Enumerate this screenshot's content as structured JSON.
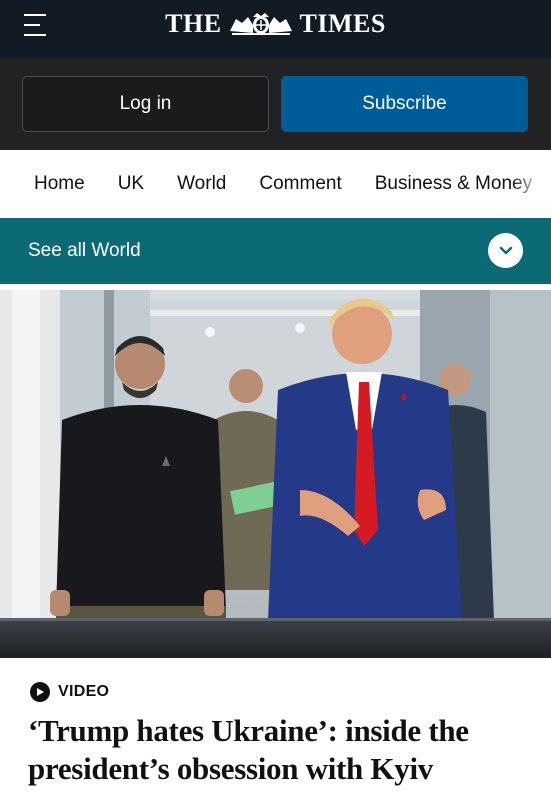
{
  "masthead": {
    "menu_icon": "hamburger-menu-icon",
    "logo_left": "THE",
    "logo_right": "TIMES",
    "crest_icon": "royal-crest-icon"
  },
  "auth": {
    "login_label": "Log in",
    "subscribe_label": "Subscribe"
  },
  "nav": {
    "items": [
      "Home",
      "UK",
      "World",
      "Comment",
      "Business & Money"
    ]
  },
  "section": {
    "see_all_label": "See all World",
    "expand_icon": "chevron-down-icon"
  },
  "article": {
    "media_type": "VIDEO",
    "play_icon": "play-circle-icon",
    "headline": "‘Trump hates Ukraine’: inside the president’s obsession with Kyiv"
  },
  "colors": {
    "masthead_bg": "#121a23",
    "authbar_bg": "#222225",
    "subscribe_bg": "#005c99",
    "section_bar_bg": "#0b6a73"
  }
}
